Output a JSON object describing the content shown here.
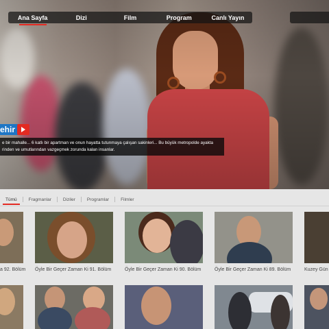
{
  "nav": {
    "items": [
      {
        "label": "Ana Sayfa",
        "active": true
      },
      {
        "label": "Dizi",
        "active": false
      },
      {
        "label": "Film",
        "active": false
      },
      {
        "label": "Program",
        "active": false
      },
      {
        "label": "Canlı Yayın",
        "active": false
      }
    ]
  },
  "hero": {
    "title": "ehir",
    "synopsis_line1": "e bir mahalle... 6 katlı bir apartman ve onun hayatta tutunmaya çalışan sakinleri... Bu büyük metropolde ayakta",
    "synopsis_line2": "rinden ve umutlarından vazgeçmek zorunda kalan insanlar.",
    "play_icon": "play-icon",
    "accent": "#e32a22",
    "title_bg": "#1e76c5"
  },
  "filters": [
    "Tümü",
    "Fragmanlar",
    "Diziler",
    "Programlar",
    "Filmler"
  ],
  "episodes_row1": [
    {
      "caption": "a 92. Bölüm"
    },
    {
      "caption": "Öyle Bir Geçer Zaman Ki 91. Bölüm"
    },
    {
      "caption": "Öyle Bir Geçer Zaman Ki 90. Bölüm"
    },
    {
      "caption": "Öyle Bir Geçer Zaman Ki 89. Bölüm"
    },
    {
      "caption": "Kuzey Gün"
    }
  ]
}
